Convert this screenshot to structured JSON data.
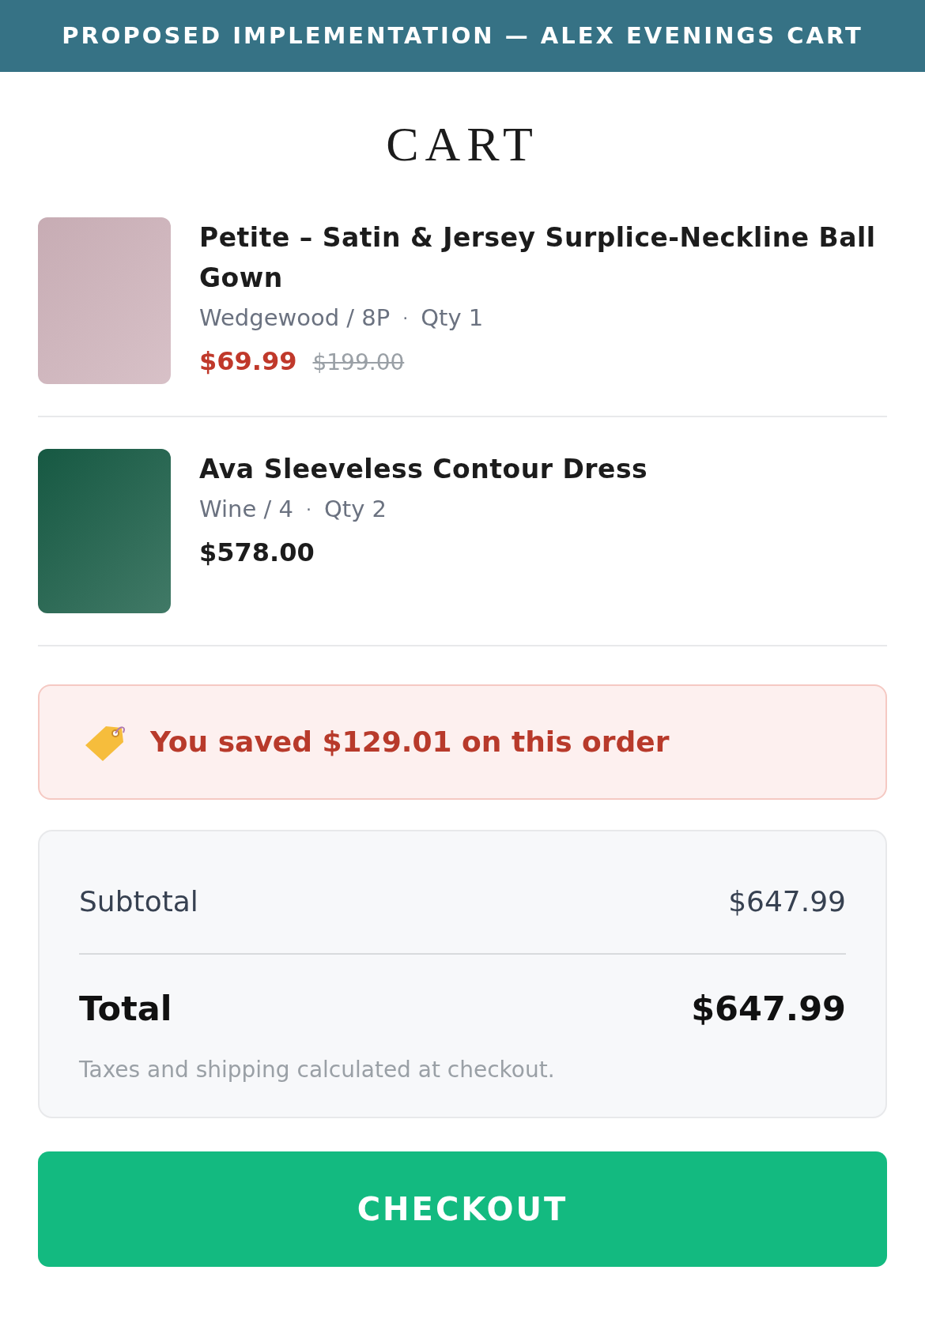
{
  "banner": {
    "title": "PROPOSED IMPLEMENTATION — ALEX EVENINGS CART"
  },
  "heading": "CART",
  "items": [
    {
      "name": "Petite – Satin & Jersey Surplice-Neckline Ball Gown",
      "variant": "Wedgewood / 8P",
      "separator": "·",
      "qty": "Qty 1",
      "kind": "sale",
      "price": "$69.99",
      "original_price": "$199.00",
      "color": "#cfb3bb"
    },
    {
      "name": "Ava Sleeveless Contour Dress",
      "variant": "Wine / 4",
      "separator": "·",
      "qty": "Qty 2",
      "kind": "regular",
      "price": "$578.00",
      "color": "#175c45"
    }
  ],
  "savings": {
    "text": "You saved $129.01 on this order"
  },
  "summary": {
    "subtotal_label": "Subtotal",
    "subtotal": "$647.99",
    "total_label": "Total",
    "total": "$647.99",
    "note": "Taxes and shipping calculated at checkout."
  },
  "checkout_button": "CHECKOUT"
}
